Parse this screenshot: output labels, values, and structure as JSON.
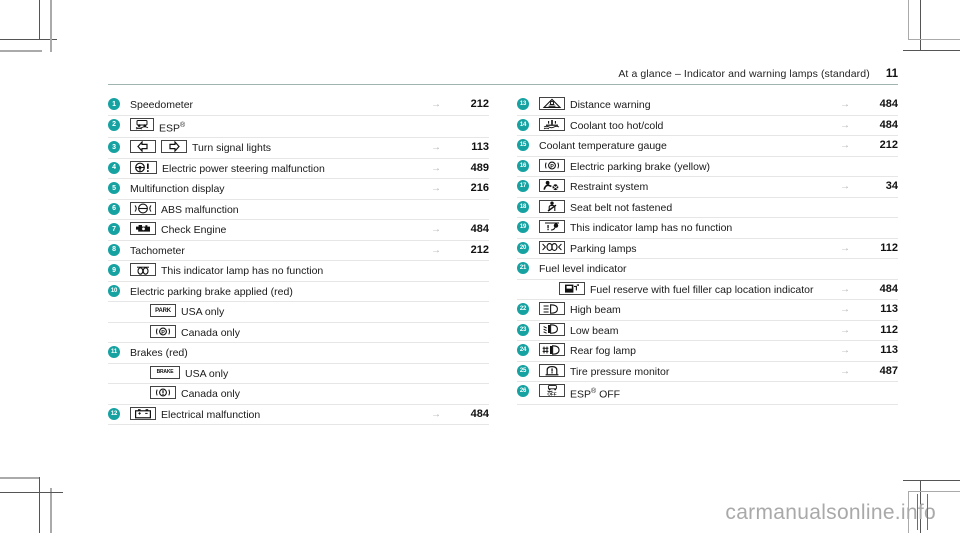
{
  "header": {
    "title": "At a glance – Indicator and warning lamps (standard)",
    "page_number": "11"
  },
  "arrow_glyph": "→",
  "watermark": "carmanualsonline.info",
  "accent_color": "#17a2a2",
  "rule_color": "#e6e6e6",
  "header_rule_color": "#9fb3b0",
  "left_column": [
    {
      "badge": "1",
      "icons": [],
      "label": "Speedometer",
      "arrow": "→",
      "page": "212"
    },
    {
      "badge": "2",
      "icons": [
        "esp"
      ],
      "label": "ESP®",
      "arrow": "",
      "page": ""
    },
    {
      "badge": "3",
      "icons": [
        "turn-left",
        "turn-right"
      ],
      "label": "Turn signal lights",
      "arrow": "→",
      "page": "113"
    },
    {
      "badge": "4",
      "icons": [
        "steering"
      ],
      "label": "Electric power steering malfunction",
      "arrow": "→",
      "page": "489"
    },
    {
      "badge": "5",
      "icons": [],
      "label": "Multifunction display",
      "arrow": "→",
      "page": "216"
    },
    {
      "badge": "6",
      "icons": [
        "abs"
      ],
      "label": "ABS malfunction",
      "arrow": "",
      "page": ""
    },
    {
      "badge": "7",
      "icons": [
        "check-engine"
      ],
      "label": "Check Engine",
      "arrow": "→",
      "page": "484"
    },
    {
      "badge": "8",
      "icons": [],
      "label": "Tachometer",
      "arrow": "→",
      "page": "212"
    },
    {
      "badge": "9",
      "icons": [
        "no-function-00"
      ],
      "label": "This indicator lamp has no function",
      "arrow": "",
      "page": ""
    },
    {
      "badge": "10",
      "icons": [],
      "label": "Electric parking brake applied (red)",
      "arrow": "",
      "page": ""
    },
    {
      "badge": "",
      "indent": true,
      "icons": [
        "park-text"
      ],
      "label": "USA only",
      "arrow": "",
      "page": ""
    },
    {
      "badge": "",
      "indent": true,
      "icons": [
        "p-circle"
      ],
      "label": "Canada only",
      "arrow": "",
      "page": ""
    },
    {
      "badge": "11",
      "icons": [],
      "label": "Brakes (red)",
      "arrow": "",
      "page": ""
    },
    {
      "badge": "",
      "indent": true,
      "icons": [
        "brake-text"
      ],
      "label": "USA only",
      "arrow": "",
      "page": ""
    },
    {
      "badge": "",
      "indent": true,
      "icons": [
        "excl-circle"
      ],
      "label": "Canada only",
      "arrow": "",
      "page": ""
    },
    {
      "badge": "12",
      "icons": [
        "battery"
      ],
      "label": "Electrical malfunction",
      "arrow": "→",
      "page": "484"
    }
  ],
  "right_column": [
    {
      "badge": "13",
      "icons": [
        "distance-warning"
      ],
      "label": "Distance warning",
      "arrow": "→",
      "page": "484"
    },
    {
      "badge": "14",
      "icons": [
        "coolant-temp"
      ],
      "label": "Coolant too hot/cold",
      "arrow": "→",
      "page": "484"
    },
    {
      "badge": "15",
      "icons": [],
      "label": "Coolant temperature gauge",
      "arrow": "→",
      "page": "212"
    },
    {
      "badge": "16",
      "icons": [
        "p-circle"
      ],
      "label": "Electric parking brake (yellow)",
      "arrow": "",
      "page": ""
    },
    {
      "badge": "17",
      "icons": [
        "restraint"
      ],
      "label": "Restraint system",
      "arrow": "→",
      "page": "34"
    },
    {
      "badge": "18",
      "icons": [
        "seatbelt"
      ],
      "label": "Seat belt not fastened",
      "arrow": "",
      "page": ""
    },
    {
      "badge": "19",
      "icons": [
        "no-function-excl"
      ],
      "label": "This indicator lamp has no function",
      "arrow": "",
      "page": ""
    },
    {
      "badge": "20",
      "icons": [
        "parking-lamps"
      ],
      "label": "Parking lamps",
      "arrow": "→",
      "page": "112"
    },
    {
      "badge": "21",
      "icons": [],
      "label": "Fuel level indicator",
      "arrow": "",
      "page": ""
    },
    {
      "badge": "",
      "indent": true,
      "icons": [
        "fuel-pump"
      ],
      "label": "Fuel reserve with fuel filler cap location indicator",
      "arrow": "→",
      "page": "484"
    },
    {
      "badge": "22",
      "icons": [
        "high-beam"
      ],
      "label": "High beam",
      "arrow": "→",
      "page": "113"
    },
    {
      "badge": "23",
      "icons": [
        "low-beam"
      ],
      "label": "Low beam",
      "arrow": "→",
      "page": "112"
    },
    {
      "badge": "24",
      "icons": [
        "rear-fog"
      ],
      "label": "Rear fog lamp",
      "arrow": "→",
      "page": "113"
    },
    {
      "badge": "25",
      "icons": [
        "tire-pressure"
      ],
      "label": "Tire pressure monitor",
      "arrow": "→",
      "page": "487"
    },
    {
      "badge": "26",
      "icons": [
        "esp-off"
      ],
      "label": "ESP® OFF",
      "arrow": "",
      "page": ""
    }
  ]
}
